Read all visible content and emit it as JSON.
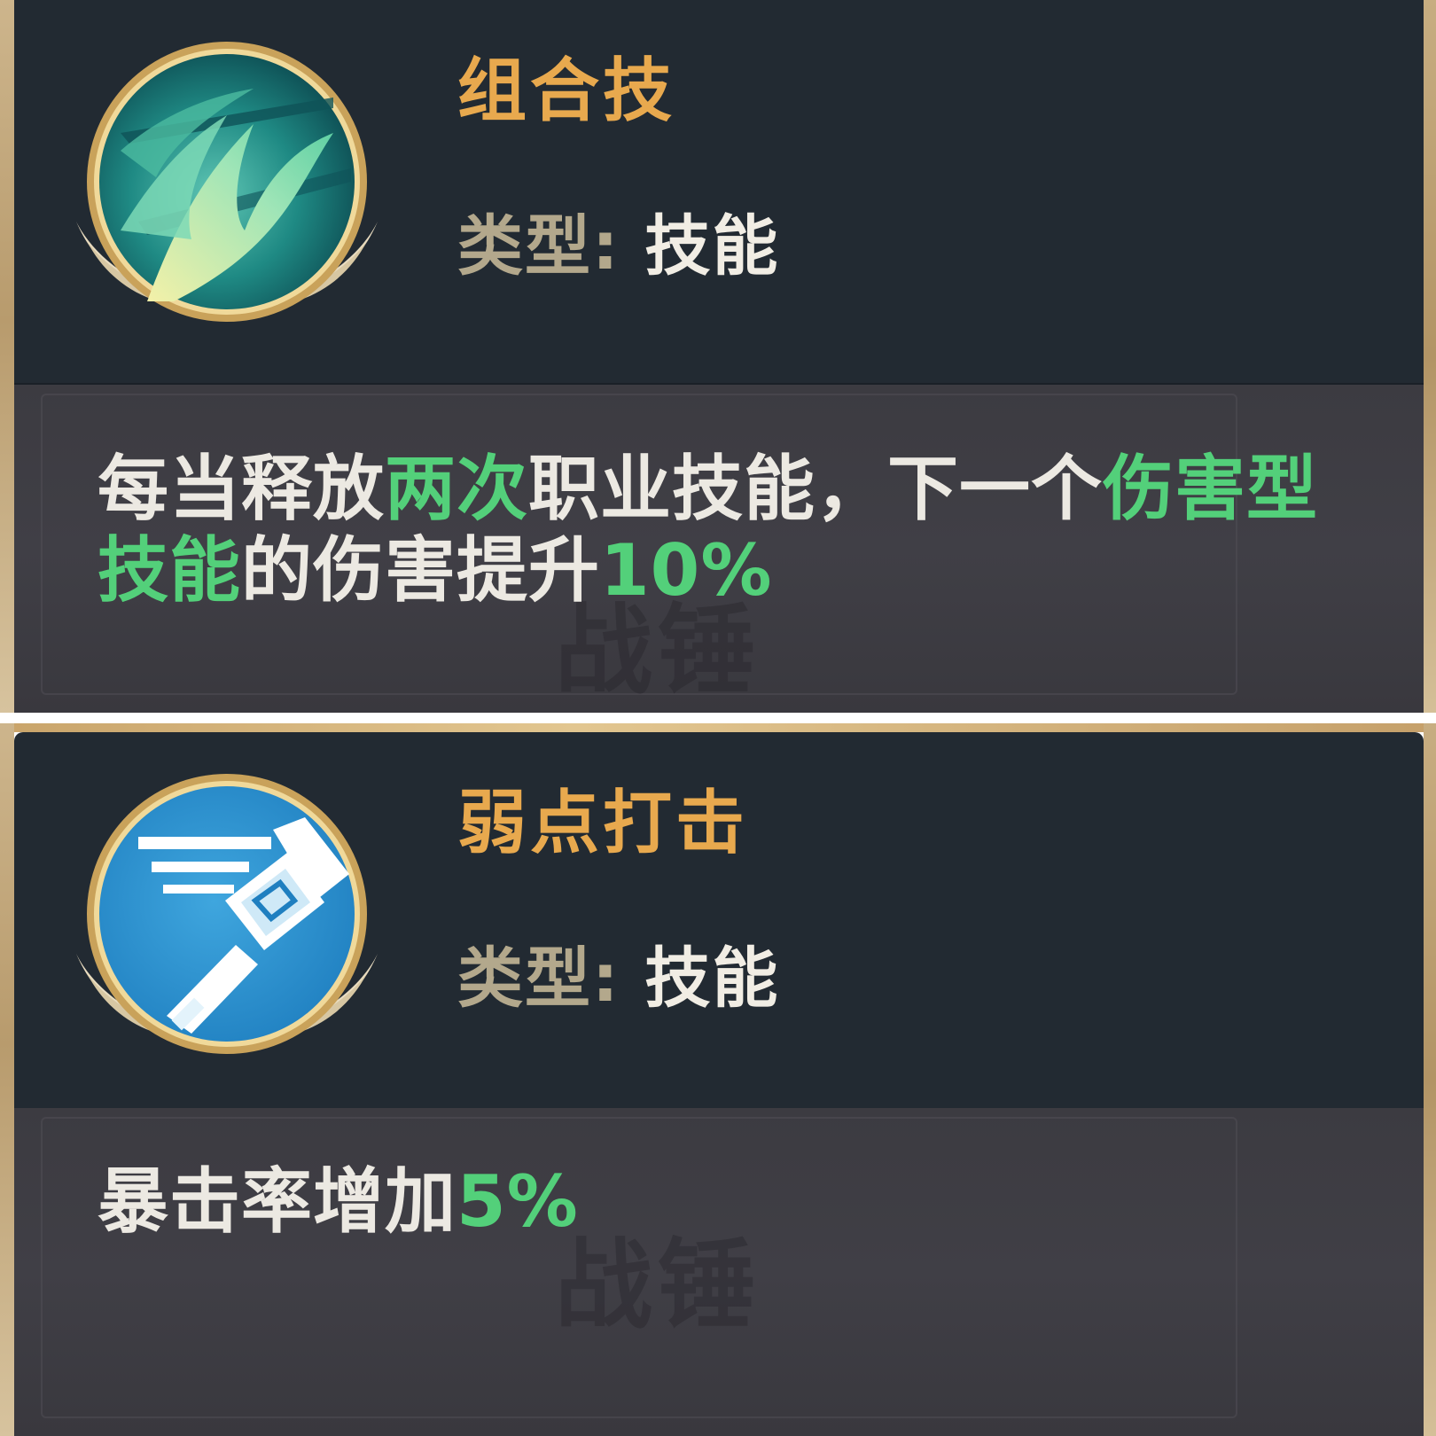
{
  "cards": [
    {
      "icon": "wave-claw-skill-icon",
      "title": "组合技",
      "type_label": "类型:",
      "type_value": "技能",
      "description": {
        "p1": "每当释放",
        "h1": "两次",
        "p2": "职业技能，下一个",
        "h2": "伤害型",
        "h3": "技能",
        "p3": "的伤害提升",
        "h4": "10%"
      },
      "watermark": "战锤"
    },
    {
      "icon": "hammer-skill-icon",
      "title": "弱点打击",
      "type_label": "类型:",
      "type_value": "技能",
      "description": {
        "p1": "暴击率增加",
        "h1": "5%"
      },
      "watermark": "战锤"
    }
  ],
  "colors": {
    "title": "#e8a94e",
    "highlight": "#53d07a",
    "text": "#ece9e2",
    "header_bg": "#222a32",
    "body_bg": "#3d3c42"
  }
}
